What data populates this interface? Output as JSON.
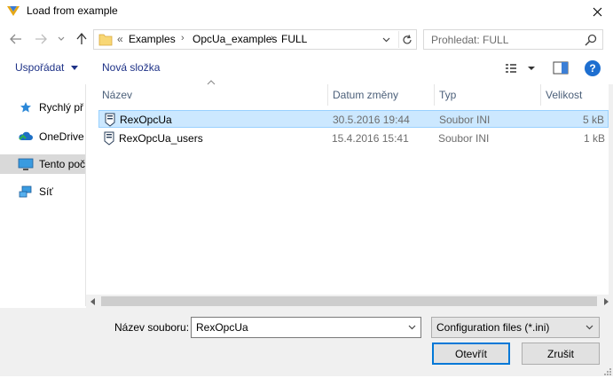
{
  "window": {
    "title": "Load from example"
  },
  "address": {
    "overflow": "«",
    "crumbs": [
      "Examples",
      "OpcUa_examples",
      "FULL"
    ]
  },
  "search": {
    "placeholder": "Prohledat: FULL"
  },
  "toolbar": {
    "organize_label": "Uspořádat",
    "new_folder_label": "Nová složka",
    "help_label": "?"
  },
  "nav": {
    "items": [
      {
        "label": "Rychlý př",
        "icon": "star-icon"
      },
      {
        "label": "OneDrive",
        "icon": "cloud-icon"
      },
      {
        "label": "Tento poč",
        "icon": "computer-icon"
      },
      {
        "label": "Síť",
        "icon": "network-icon"
      }
    ]
  },
  "columns": [
    "Název",
    "Datum změny",
    "Typ",
    "Velikost"
  ],
  "files": [
    {
      "name": "RexOpcUa",
      "date": "30.5.2016 19:44",
      "type": "Soubor INI",
      "size": "5 kB",
      "selected": true
    },
    {
      "name": "RexOpcUa_users",
      "date": "15.4.2016 15:41",
      "type": "Soubor INI",
      "size": "1 kB",
      "selected": false
    }
  ],
  "footer": {
    "filename_label": "Název souboru:",
    "filename_value": "RexOpcUa",
    "filter_value": "Configuration files (*.ini)",
    "open_label": "Otevřít",
    "cancel_label": "Zrušit"
  },
  "colors": {
    "accent": "#0078d7",
    "selection": "#cce8ff",
    "link": "#1e3287"
  }
}
